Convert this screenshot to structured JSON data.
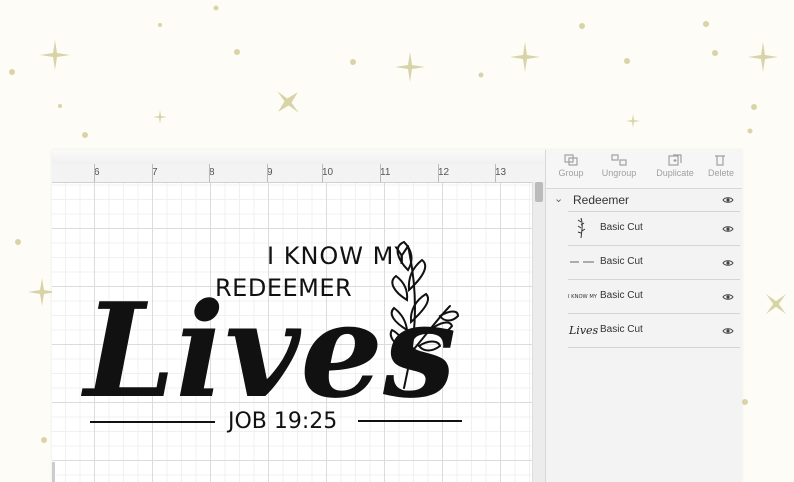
{
  "canvas": {
    "ruler_marks": [
      "6",
      "7",
      "8",
      "9",
      "10",
      "11",
      "12",
      "13"
    ]
  },
  "design": {
    "line1": "I KNOW MY",
    "line2": "REDEEMER",
    "script_word": "Lives",
    "reference": "JOB 19:25"
  },
  "toolbar": {
    "group_label": "Group",
    "ungroup_label": "Ungroup",
    "duplicate_label": "Duplicate",
    "delete_label": "Delete"
  },
  "layers": {
    "group_name": "Redeemer",
    "items": [
      {
        "thumb_icon": "leaf-thumbnail-icon",
        "label": "Basic Cut"
      },
      {
        "thumb_icon": "line-thumbnail-icon",
        "label": "Basic Cut"
      },
      {
        "thumb_icon": "text-thumbnail-icon",
        "thumb_text": "I KNOW MY",
        "label": "Basic Cut"
      },
      {
        "thumb_icon": "lives-thumbnail-icon",
        "thumb_text": "Lives",
        "label": "Basic Cut"
      }
    ]
  },
  "colors": {
    "sparkle": "#d9d4a8",
    "ink": "#111111",
    "panel": "#f3f3f3"
  }
}
